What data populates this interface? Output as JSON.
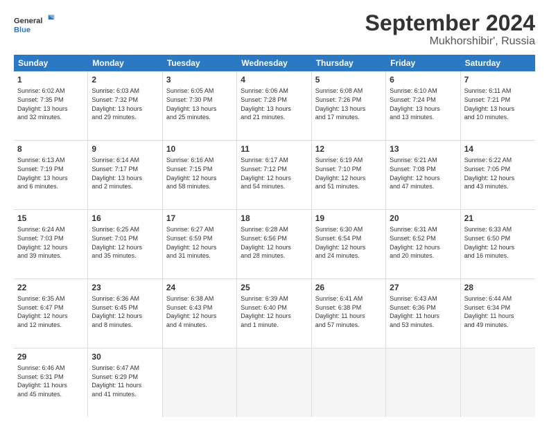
{
  "logo": {
    "line1": "General",
    "line2": "Blue"
  },
  "title": "September 2024",
  "location": "Mukhorshibir', Russia",
  "header_days": [
    "Sunday",
    "Monday",
    "Tuesday",
    "Wednesday",
    "Thursday",
    "Friday",
    "Saturday"
  ],
  "weeks": [
    [
      {
        "day": "1",
        "lines": [
          "Sunrise: 6:02 AM",
          "Sunset: 7:35 PM",
          "Daylight: 13 hours",
          "and 32 minutes."
        ]
      },
      {
        "day": "2",
        "lines": [
          "Sunrise: 6:03 AM",
          "Sunset: 7:32 PM",
          "Daylight: 13 hours",
          "and 29 minutes."
        ]
      },
      {
        "day": "3",
        "lines": [
          "Sunrise: 6:05 AM",
          "Sunset: 7:30 PM",
          "Daylight: 13 hours",
          "and 25 minutes."
        ]
      },
      {
        "day": "4",
        "lines": [
          "Sunrise: 6:06 AM",
          "Sunset: 7:28 PM",
          "Daylight: 13 hours",
          "and 21 minutes."
        ]
      },
      {
        "day": "5",
        "lines": [
          "Sunrise: 6:08 AM",
          "Sunset: 7:26 PM",
          "Daylight: 13 hours",
          "and 17 minutes."
        ]
      },
      {
        "day": "6",
        "lines": [
          "Sunrise: 6:10 AM",
          "Sunset: 7:24 PM",
          "Daylight: 13 hours",
          "and 13 minutes."
        ]
      },
      {
        "day": "7",
        "lines": [
          "Sunrise: 6:11 AM",
          "Sunset: 7:21 PM",
          "Daylight: 13 hours",
          "and 10 minutes."
        ]
      }
    ],
    [
      {
        "day": "8",
        "lines": [
          "Sunrise: 6:13 AM",
          "Sunset: 7:19 PM",
          "Daylight: 13 hours",
          "and 6 minutes."
        ]
      },
      {
        "day": "9",
        "lines": [
          "Sunrise: 6:14 AM",
          "Sunset: 7:17 PM",
          "Daylight: 13 hours",
          "and 2 minutes."
        ]
      },
      {
        "day": "10",
        "lines": [
          "Sunrise: 6:16 AM",
          "Sunset: 7:15 PM",
          "Daylight: 12 hours",
          "and 58 minutes."
        ]
      },
      {
        "day": "11",
        "lines": [
          "Sunrise: 6:17 AM",
          "Sunset: 7:12 PM",
          "Daylight: 12 hours",
          "and 54 minutes."
        ]
      },
      {
        "day": "12",
        "lines": [
          "Sunrise: 6:19 AM",
          "Sunset: 7:10 PM",
          "Daylight: 12 hours",
          "and 51 minutes."
        ]
      },
      {
        "day": "13",
        "lines": [
          "Sunrise: 6:21 AM",
          "Sunset: 7:08 PM",
          "Daylight: 12 hours",
          "and 47 minutes."
        ]
      },
      {
        "day": "14",
        "lines": [
          "Sunrise: 6:22 AM",
          "Sunset: 7:05 PM",
          "Daylight: 12 hours",
          "and 43 minutes."
        ]
      }
    ],
    [
      {
        "day": "15",
        "lines": [
          "Sunrise: 6:24 AM",
          "Sunset: 7:03 PM",
          "Daylight: 12 hours",
          "and 39 minutes."
        ]
      },
      {
        "day": "16",
        "lines": [
          "Sunrise: 6:25 AM",
          "Sunset: 7:01 PM",
          "Daylight: 12 hours",
          "and 35 minutes."
        ]
      },
      {
        "day": "17",
        "lines": [
          "Sunrise: 6:27 AM",
          "Sunset: 6:59 PM",
          "Daylight: 12 hours",
          "and 31 minutes."
        ]
      },
      {
        "day": "18",
        "lines": [
          "Sunrise: 6:28 AM",
          "Sunset: 6:56 PM",
          "Daylight: 12 hours",
          "and 28 minutes."
        ]
      },
      {
        "day": "19",
        "lines": [
          "Sunrise: 6:30 AM",
          "Sunset: 6:54 PM",
          "Daylight: 12 hours",
          "and 24 minutes."
        ]
      },
      {
        "day": "20",
        "lines": [
          "Sunrise: 6:31 AM",
          "Sunset: 6:52 PM",
          "Daylight: 12 hours",
          "and 20 minutes."
        ]
      },
      {
        "day": "21",
        "lines": [
          "Sunrise: 6:33 AM",
          "Sunset: 6:50 PM",
          "Daylight: 12 hours",
          "and 16 minutes."
        ]
      }
    ],
    [
      {
        "day": "22",
        "lines": [
          "Sunrise: 6:35 AM",
          "Sunset: 6:47 PM",
          "Daylight: 12 hours",
          "and 12 minutes."
        ]
      },
      {
        "day": "23",
        "lines": [
          "Sunrise: 6:36 AM",
          "Sunset: 6:45 PM",
          "Daylight: 12 hours",
          "and 8 minutes."
        ]
      },
      {
        "day": "24",
        "lines": [
          "Sunrise: 6:38 AM",
          "Sunset: 6:43 PM",
          "Daylight: 12 hours",
          "and 4 minutes."
        ]
      },
      {
        "day": "25",
        "lines": [
          "Sunrise: 6:39 AM",
          "Sunset: 6:40 PM",
          "Daylight: 12 hours",
          "and 1 minute."
        ]
      },
      {
        "day": "26",
        "lines": [
          "Sunrise: 6:41 AM",
          "Sunset: 6:38 PM",
          "Daylight: 11 hours",
          "and 57 minutes."
        ]
      },
      {
        "day": "27",
        "lines": [
          "Sunrise: 6:43 AM",
          "Sunset: 6:36 PM",
          "Daylight: 11 hours",
          "and 53 minutes."
        ]
      },
      {
        "day": "28",
        "lines": [
          "Sunrise: 6:44 AM",
          "Sunset: 6:34 PM",
          "Daylight: 11 hours",
          "and 49 minutes."
        ]
      }
    ],
    [
      {
        "day": "29",
        "lines": [
          "Sunrise: 6:46 AM",
          "Sunset: 6:31 PM",
          "Daylight: 11 hours",
          "and 45 minutes."
        ]
      },
      {
        "day": "30",
        "lines": [
          "Sunrise: 6:47 AM",
          "Sunset: 6:29 PM",
          "Daylight: 11 hours",
          "and 41 minutes."
        ]
      },
      {
        "day": "",
        "lines": []
      },
      {
        "day": "",
        "lines": []
      },
      {
        "day": "",
        "lines": []
      },
      {
        "day": "",
        "lines": []
      },
      {
        "day": "",
        "lines": []
      }
    ]
  ]
}
